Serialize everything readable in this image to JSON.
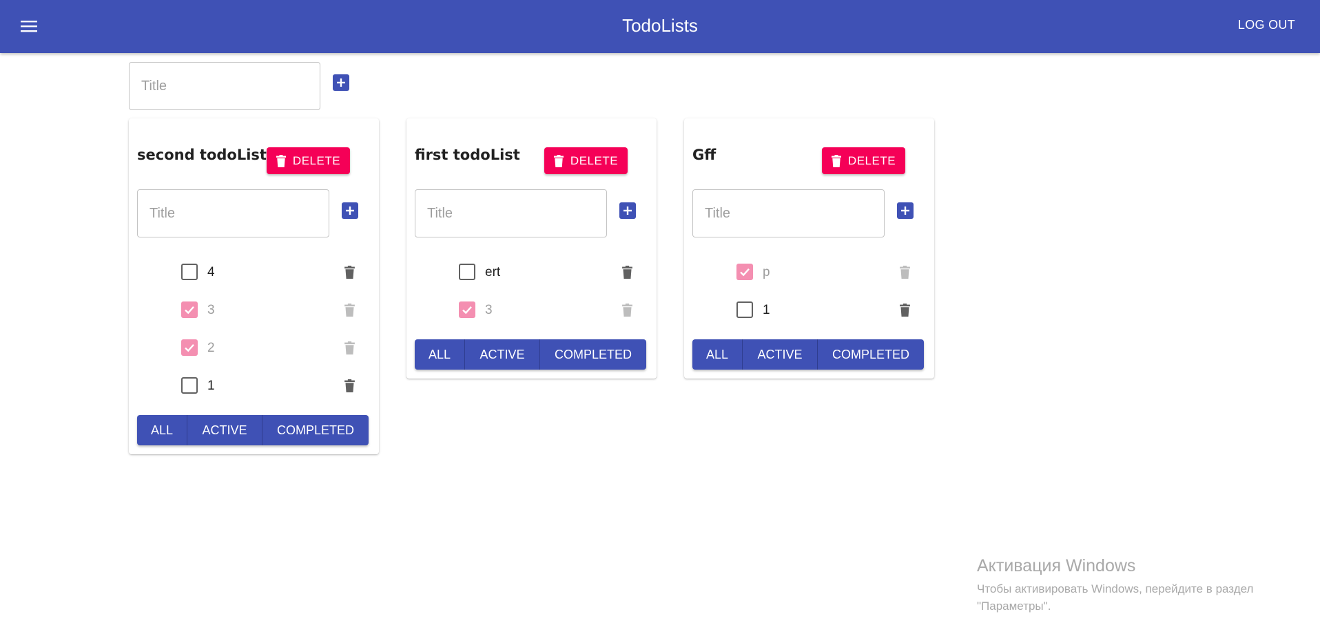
{
  "appbar": {
    "title": "TodoLists",
    "logout_label": "LOG OUT",
    "menu_icon": "hamburger-menu-icon",
    "color": "#3f51b5"
  },
  "new_list": {
    "placeholder": "Title",
    "add_icon": "plus-box-icon"
  },
  "colors": {
    "delete_button": "#f50057",
    "checked_checkbox": "#f48fb1",
    "primary": "#3f51b5"
  },
  "todolists": [
    {
      "title": "second todoList",
      "delete_label": "DELETE",
      "input_placeholder": "Title",
      "tasks": [
        {
          "title": "4",
          "done": false
        },
        {
          "title": "3",
          "done": true
        },
        {
          "title": "2",
          "done": true
        },
        {
          "title": "1",
          "done": false
        }
      ],
      "filters": {
        "all": "ALL",
        "active": "ACTIVE",
        "completed": "COMPLETED"
      }
    },
    {
      "title": "first todoList",
      "delete_label": "DELETE",
      "input_placeholder": "Title",
      "tasks": [
        {
          "title": "ert",
          "done": false
        },
        {
          "title": "3",
          "done": true
        }
      ],
      "filters": {
        "all": "ALL",
        "active": "ACTIVE",
        "completed": "COMPLETED"
      }
    },
    {
      "title": "Gff",
      "delete_label": "DELETE",
      "input_placeholder": "Title",
      "tasks": [
        {
          "title": "p",
          "done": true
        },
        {
          "title": "1",
          "done": false
        }
      ],
      "filters": {
        "all": "ALL",
        "active": "ACTIVE",
        "completed": "COMPLETED"
      }
    }
  ],
  "watermark": {
    "title": "Активация Windows",
    "line1": "Чтобы активировать Windows, перейдите в раздел",
    "line2": "\"Параметры\"."
  }
}
